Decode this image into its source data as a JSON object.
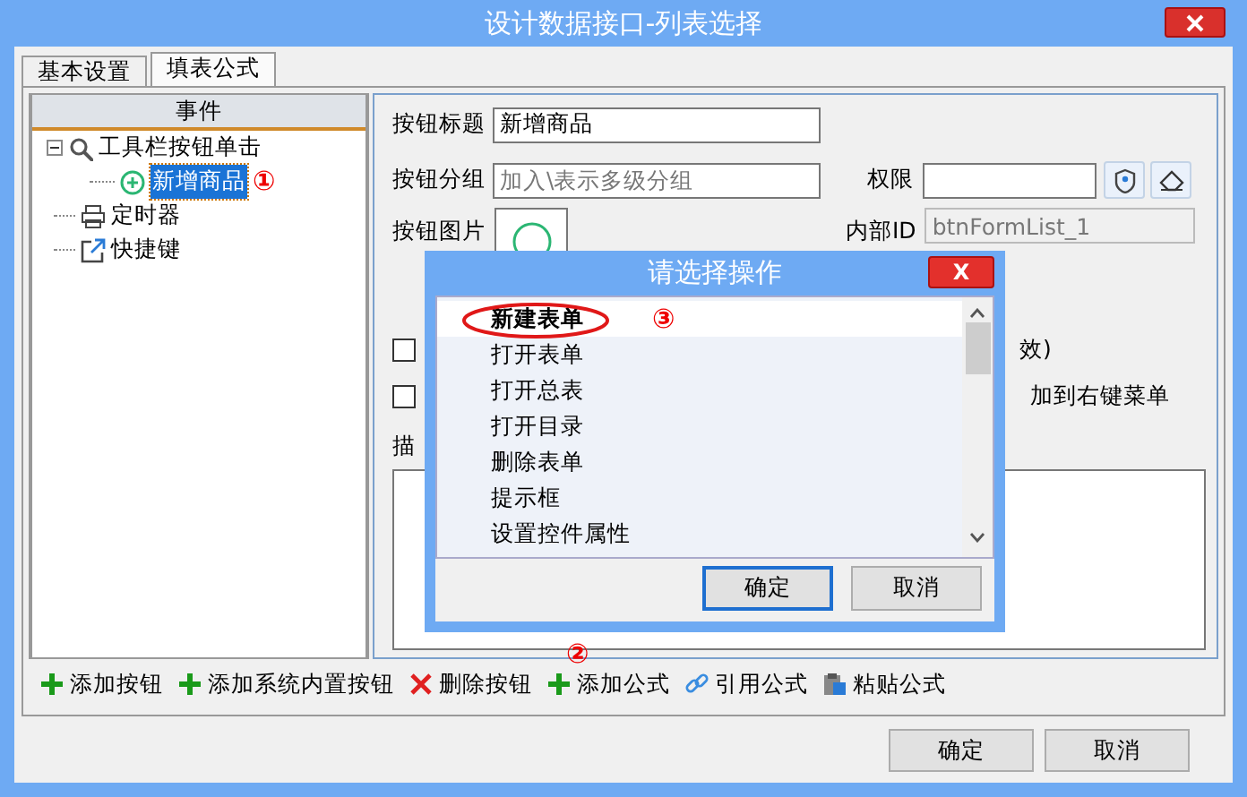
{
  "window": {
    "title": "设计数据接口-列表选择"
  },
  "tabs": [
    {
      "label": "基本设置",
      "selected": false
    },
    {
      "label": "填表公式",
      "selected": true
    }
  ],
  "event_tree": {
    "header": "事件",
    "items": [
      {
        "label": "工具栏按钮单击",
        "kind": "toolbar",
        "expanded": true,
        "selected": false,
        "children": [
          {
            "label": "新增商品",
            "kind": "button",
            "selected": true,
            "annotation": "①"
          }
        ]
      },
      {
        "label": "定时器",
        "kind": "timer",
        "selected": false
      },
      {
        "label": "快捷键",
        "kind": "shortcut",
        "selected": false
      }
    ]
  },
  "form": {
    "title_label": "按钮标题",
    "title_value": "新增商品",
    "group_label": "按钮分组",
    "group_placeholder": "加入\\表示多级分组",
    "permission_label": "权限",
    "image_label": "按钮图片",
    "internal_id_label": "内部ID",
    "internal_id_value": "btnFormList_1",
    "checkboxes": [
      {
        "checked": false,
        "tail": "效)"
      },
      {
        "checked": false,
        "tail": "加到右键菜单"
      }
    ],
    "description_label": "描"
  },
  "toolbar": [
    {
      "label": "添加按钮",
      "kind": "add"
    },
    {
      "label": "添加系统内置按钮",
      "kind": "add"
    },
    {
      "label": "删除按钮",
      "kind": "delete"
    },
    {
      "label": "添加公式",
      "kind": "add",
      "annotation": "②"
    },
    {
      "label": "引用公式",
      "kind": "link"
    },
    {
      "label": "粘贴公式",
      "kind": "paste"
    }
  ],
  "buttons": [
    "确定",
    "取消"
  ],
  "dialog": {
    "title": "请选择操作",
    "close": "X",
    "items": [
      {
        "label": "新建表单",
        "selected": true,
        "circled": true,
        "annotation": "③"
      },
      {
        "label": "打开表单",
        "selected": false,
        "circled": false
      },
      {
        "label": "打开总表",
        "selected": false,
        "circled": false
      },
      {
        "label": "打开目录",
        "selected": false,
        "circled": false
      },
      {
        "label": "删除表单",
        "selected": false,
        "circled": false
      },
      {
        "label": "提示框",
        "selected": false,
        "circled": false
      },
      {
        "label": "设置控件属性",
        "selected": false,
        "circled": false
      }
    ],
    "buttons": [
      "确定",
      "取消"
    ]
  }
}
